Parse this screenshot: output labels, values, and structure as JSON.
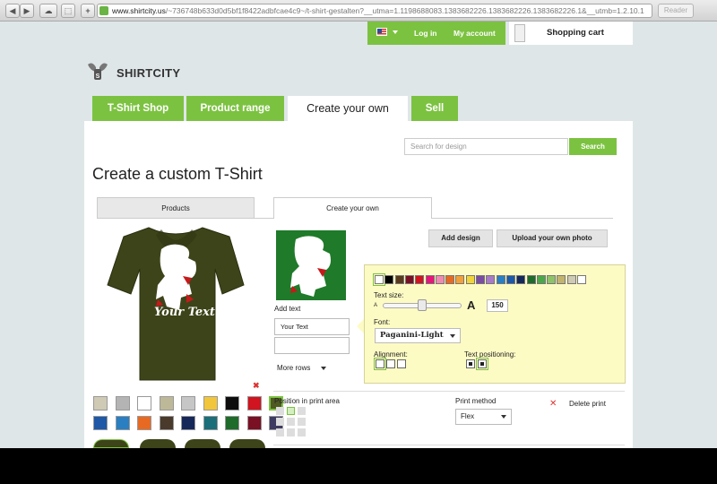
{
  "browser": {
    "url_host": "www.shirtcity.us",
    "url_rest": "/~736748b633d0d5bf1f8422adbfcae4c9~/t-shirt-gestalten?__utma=1.1198688083.1383682226.1383682226.1383682226.1&__utmb=1.2.10.1",
    "reader_label": "Reader"
  },
  "account": {
    "login_label": "Log in",
    "my_account_label": "My account",
    "cart_label": "Shopping cart"
  },
  "logo": {
    "text": "SHIRTCITY"
  },
  "nav": {
    "tabs": [
      "T-Shirt Shop",
      "Product range",
      "Create your own",
      "Sell"
    ]
  },
  "search": {
    "placeholder": "Search for design",
    "button": "Search"
  },
  "page": {
    "title": "Create a custom T-Shirt",
    "subtabs": [
      "Products",
      "Create your own"
    ]
  },
  "shirt": {
    "text": "Your Text",
    "colors": [
      "#cfcab4",
      "#b4b4b4",
      "#ffffff",
      "#bdb898",
      "#c6c6c6",
      "#f2c63a",
      "#0d0d0d",
      "#d01420",
      "#4f5a22",
      "#1e58a6",
      "#2a7fc2",
      "#e86a22",
      "#4a3a2c",
      "#16285a",
      "#1a6f7a",
      "#1f6b2a",
      "#7a1024",
      "#3e3c62"
    ]
  },
  "design": {
    "add_text_label": "Add text",
    "text_line1": "Your Text",
    "text_line2": "",
    "more_rows_label": "More rows",
    "add_design_button": "Add design",
    "upload_button": "Upload your own photo"
  },
  "text_options": {
    "colors": [
      "#ffffff",
      "#000000",
      "#5a3a1c",
      "#7a1024",
      "#d01420",
      "#e8147a",
      "#f08ab0",
      "#e86a22",
      "#f2a03a",
      "#f2d43a",
      "#7a4ca2",
      "#a87ac8",
      "#2a7fc2",
      "#1e58a6",
      "#16285a",
      "#1f6b2a",
      "#4aa84a",
      "#8ec36a",
      "#c2b46e",
      "#cfcab4",
      "#ffffff"
    ],
    "size_label": "Text size:",
    "size_small": "A",
    "size_large": "A",
    "size_value": "150",
    "font_label": "Font:",
    "font_value": "Paganini-Light",
    "alignment_label": "Alignment:",
    "positioning_label": "Text positioning:"
  },
  "print": {
    "position_label": "Position in print area",
    "method_label": "Print method",
    "method_value": "Flex",
    "delete_label": "Delete print"
  }
}
